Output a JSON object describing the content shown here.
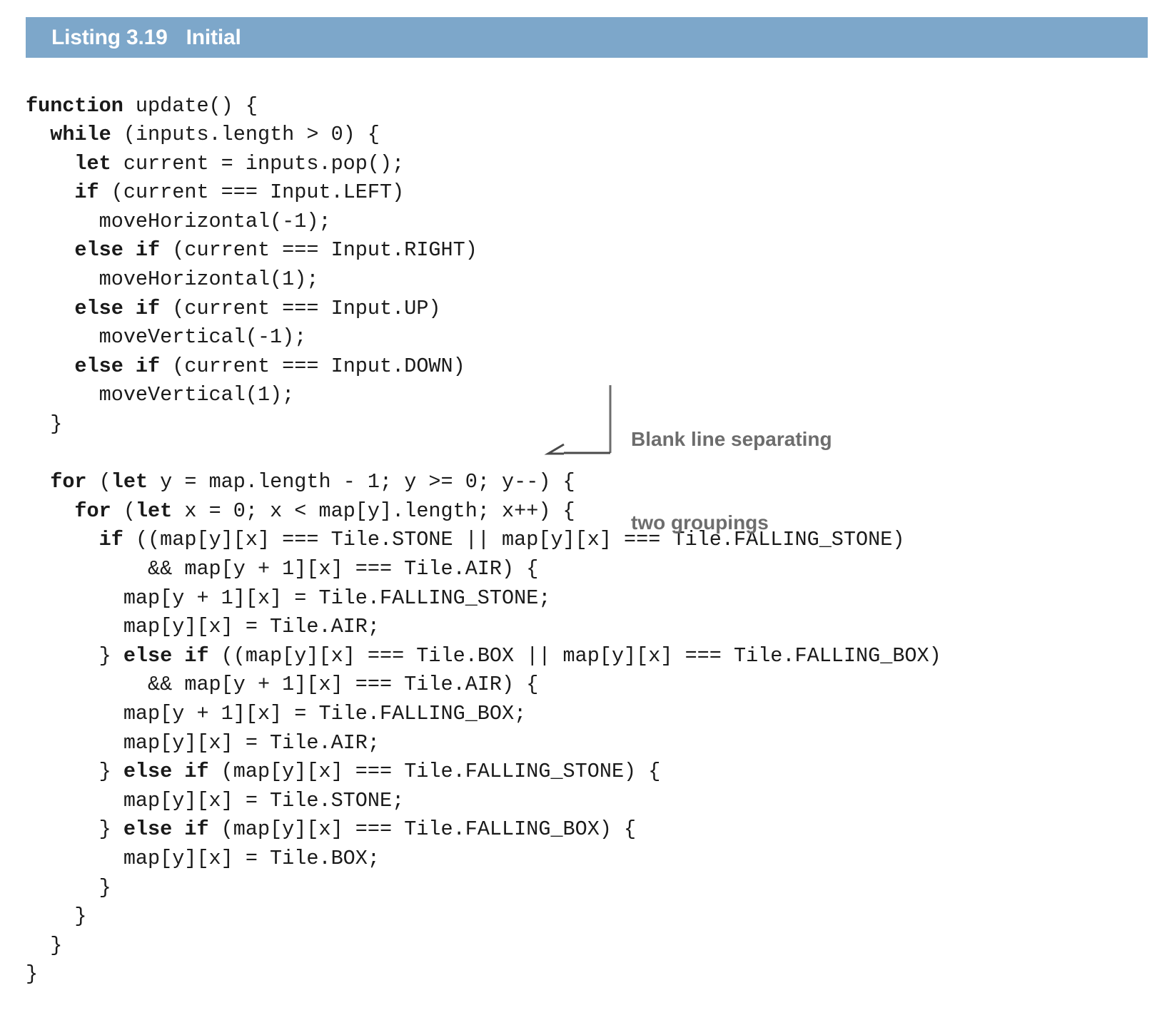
{
  "header": {
    "listing_label": "Listing 3.19",
    "listing_title": "Initial",
    "bar_color": "#7da7ca",
    "text_color": "#ffffff"
  },
  "annotation": {
    "line1": "Blank line separating",
    "line2": "two groupings",
    "color": "#6d6d6d",
    "arrow": "left-open-chevron-arrow"
  },
  "code": {
    "language": "javascript",
    "keyword_style": "bold",
    "text_color": "#1a1a1a",
    "lines": [
      {
        "indent": 0,
        "kw": "function",
        "rest": " update() {"
      },
      {
        "indent": 2,
        "kw": "while",
        "rest": " (inputs.length > 0) {"
      },
      {
        "indent": 4,
        "kw": "let",
        "rest": " current = inputs.pop();"
      },
      {
        "indent": 4,
        "kw": "if",
        "rest": " (current === Input.LEFT)"
      },
      {
        "indent": 6,
        "kw": "",
        "rest": "moveHorizontal(-1);"
      },
      {
        "indent": 4,
        "kw": "else if",
        "rest": " (current === Input.RIGHT)"
      },
      {
        "indent": 6,
        "kw": "",
        "rest": "moveHorizontal(1);"
      },
      {
        "indent": 4,
        "kw": "else if",
        "rest": " (current === Input.UP)"
      },
      {
        "indent": 6,
        "kw": "",
        "rest": "moveVertical(-1);"
      },
      {
        "indent": 4,
        "kw": "else if",
        "rest": " (current === Input.DOWN)"
      },
      {
        "indent": 6,
        "kw": "",
        "rest": "moveVertical(1);"
      },
      {
        "indent": 2,
        "kw": "",
        "rest": "}"
      },
      {
        "indent": 0,
        "kw": "",
        "rest": ""
      },
      {
        "indent": 2,
        "kw": "for",
        "rest": " (",
        "kw2": "let",
        "rest2": " y = map.length - 1; y >= 0; y--) {"
      },
      {
        "indent": 4,
        "kw": "for",
        "rest": " (",
        "kw2": "let",
        "rest2": " x = 0; x < map[y].length; x++) {"
      },
      {
        "indent": 6,
        "kw": "if",
        "rest": " ((map[y][x] === Tile.STONE || map[y][x] === Tile.FALLING_STONE)"
      },
      {
        "indent": 10,
        "kw": "",
        "rest": "&& map[y + 1][x] === Tile.AIR) {"
      },
      {
        "indent": 8,
        "kw": "",
        "rest": "map[y + 1][x] = Tile.FALLING_STONE;"
      },
      {
        "indent": 8,
        "kw": "",
        "rest": "map[y][x] = Tile.AIR;"
      },
      {
        "indent": 6,
        "pre": "} ",
        "kw": "else if",
        "rest": " ((map[y][x] === Tile.BOX || map[y][x] === Tile.FALLING_BOX)"
      },
      {
        "indent": 10,
        "kw": "",
        "rest": "&& map[y + 1][x] === Tile.AIR) {"
      },
      {
        "indent": 8,
        "kw": "",
        "rest": "map[y + 1][x] = Tile.FALLING_BOX;"
      },
      {
        "indent": 8,
        "kw": "",
        "rest": "map[y][x] = Tile.AIR;"
      },
      {
        "indent": 6,
        "pre": "} ",
        "kw": "else if",
        "rest": " (map[y][x] === Tile.FALLING_STONE) {"
      },
      {
        "indent": 8,
        "kw": "",
        "rest": "map[y][x] = Tile.STONE;"
      },
      {
        "indent": 6,
        "pre": "} ",
        "kw": "else if",
        "rest": " (map[y][x] === Tile.FALLING_BOX) {"
      },
      {
        "indent": 8,
        "kw": "",
        "rest": "map[y][x] = Tile.BOX;"
      },
      {
        "indent": 6,
        "kw": "",
        "rest": "}"
      },
      {
        "indent": 4,
        "kw": "",
        "rest": "}"
      },
      {
        "indent": 2,
        "kw": "",
        "rest": "}"
      },
      {
        "indent": 0,
        "kw": "",
        "rest": "}"
      }
    ]
  }
}
